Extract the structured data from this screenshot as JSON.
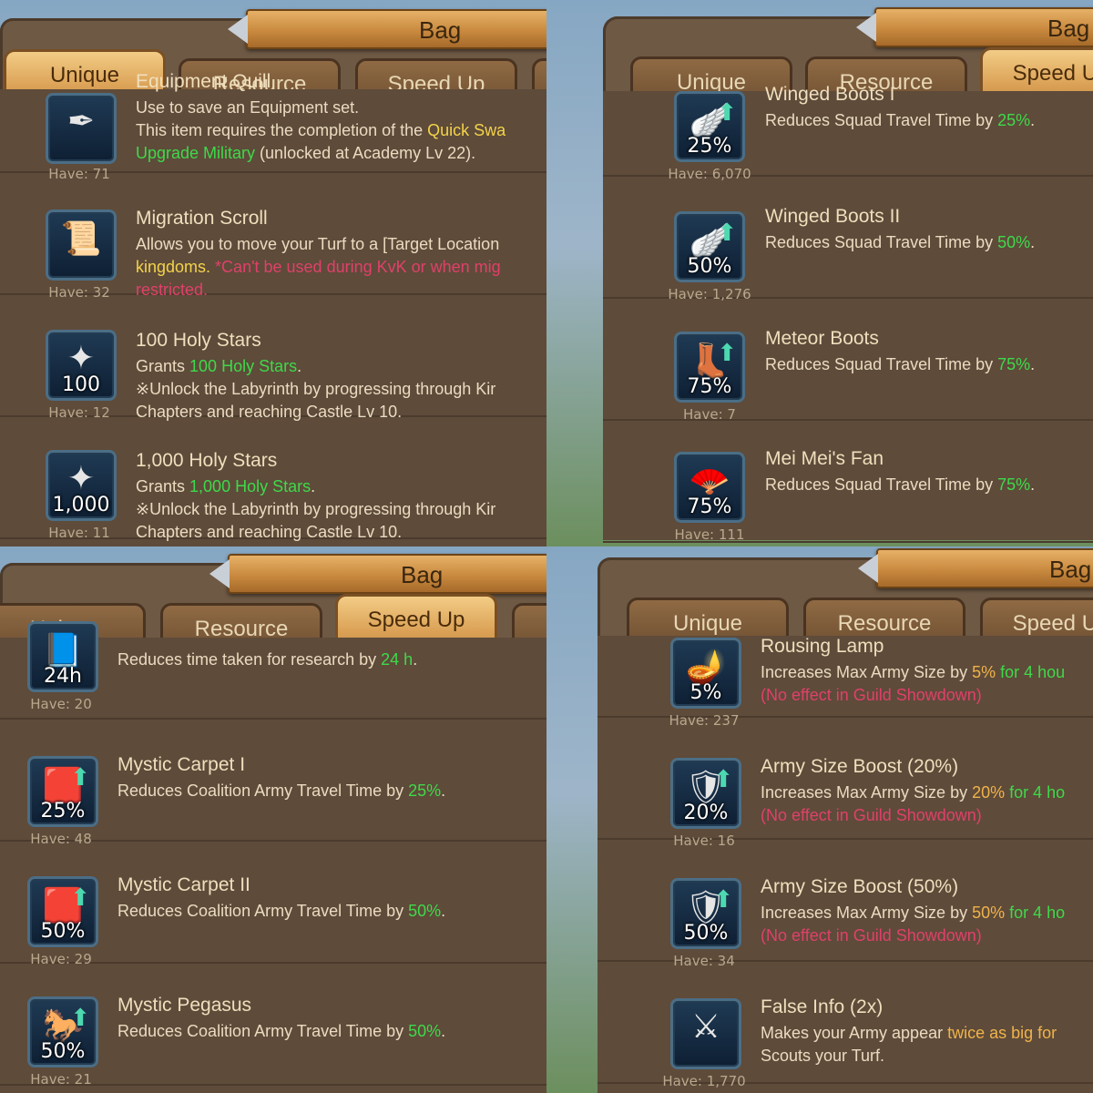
{
  "window_title": "Bag",
  "tabs": [
    "Unique",
    "Resource",
    "Speed Up"
  ],
  "panel_tl": {
    "items": [
      {
        "name": "Equipment Quill",
        "have": "Have: 71",
        "desc1": "Use to save an Equipment set.",
        "desc2a": "This item requires the completion of the ",
        "desc2b": "Quick Swa",
        "desc3a": "Upgrade Military",
        "desc3b": " (unlocked at Academy Lv 22)."
      },
      {
        "name": "Migration Scroll",
        "have": "Have: 32",
        "desc1": "Allows you to move your Turf to a [Target Location",
        "desc2a": "kingdoms.",
        "desc2b": " *Can't be used during KvK or when mig",
        "desc3": "restricted."
      },
      {
        "name": "100 Holy Stars",
        "have": "Have: 12",
        "badge": "100",
        "desc1a": "Grants ",
        "desc1b": "100 Holy Stars",
        "desc1c": ".",
        "desc2": "※Unlock the Labyrinth by progressing through Kir",
        "desc3": "Chapters and reaching Castle Lv 10."
      },
      {
        "name": "1,000 Holy Stars",
        "have": "Have: 11",
        "badge": "1,000",
        "desc1a": "Grants ",
        "desc1b": "1,000 Holy Stars",
        "desc1c": ".",
        "desc2": "※Unlock the Labyrinth by progressing through Kir",
        "desc3": "Chapters and reaching Castle Lv 10."
      }
    ]
  },
  "panel_tr": {
    "items": [
      {
        "name": "Winged Boots I",
        "have": "Have: 6,070",
        "badge": "25%",
        "desc_a": "Reduces Squad Travel Time by ",
        "desc_b": "25%",
        "desc_c": "."
      },
      {
        "name": "Winged Boots II",
        "have": "Have: 1,276",
        "badge": "50%",
        "desc_a": "Reduces Squad Travel Time by ",
        "desc_b": "50%",
        "desc_c": "."
      },
      {
        "name": "Meteor Boots",
        "have": "Have: 7",
        "badge": "75%",
        "desc_a": "Reduces Squad Travel Time by ",
        "desc_b": "75%",
        "desc_c": "."
      },
      {
        "name": "Mei Mei's Fan",
        "have": "Have: 111",
        "badge": "75%",
        "desc_a": "Reduces Squad Travel Time by ",
        "desc_b": "75%",
        "desc_c": "."
      }
    ]
  },
  "panel_bl": {
    "items": [
      {
        "name": "",
        "have": "Have: 20",
        "badge": "24h",
        "desc_a": "Reduces time taken for research by ",
        "desc_b": "24 h",
        "desc_c": "."
      },
      {
        "name": "Mystic Carpet I",
        "have": "Have: 48",
        "badge": "25%",
        "desc_a": "Reduces Coalition Army Travel Time by ",
        "desc_b": "25%",
        "desc_c": "."
      },
      {
        "name": "Mystic Carpet II",
        "have": "Have: 29",
        "badge": "50%",
        "desc_a": "Reduces Coalition Army Travel Time by ",
        "desc_b": "50%",
        "desc_c": "."
      },
      {
        "name": "Mystic Pegasus",
        "have": "Have: 21",
        "badge": "50%",
        "desc_a": "Reduces Coalition Army Travel Time by ",
        "desc_b": "50%",
        "desc_c": "."
      }
    ]
  },
  "panel_br": {
    "items": [
      {
        "name": "Rousing Lamp",
        "have": "Have: 237",
        "badge": "5%",
        "desc1a": "Increases Max Army Size by ",
        "desc1b": "5%",
        "desc1c": " for 4 hou",
        "desc2": "(No effect in Guild Showdown)"
      },
      {
        "name": "Army Size Boost (20%)",
        "have": "Have: 16",
        "badge": "20%",
        "desc1a": "Increases Max Army Size by ",
        "desc1b": "20%",
        "desc1c": " for 4 ho",
        "desc2": "(No effect in Guild Showdown)"
      },
      {
        "name": "Army Size Boost (50%)",
        "have": "Have: 34",
        "badge": "50%",
        "desc1a": "Increases Max Army Size by ",
        "desc1b": "50%",
        "desc1c": " for 4 ho",
        "desc2": "(No effect in Guild Showdown)"
      },
      {
        "name": "False Info (2x)",
        "have": "Have: 1,770",
        "desc1a": "Makes your Army appear ",
        "desc1b": "twice as big",
        "desc1c": " for",
        "desc2": "Scouts your Turf."
      }
    ]
  },
  "colors": {
    "highlight_green": "#3fd94a",
    "highlight_yellow": "#f3d34a",
    "warning_red": "#e0406a",
    "highlight_orange": "#f0b34a"
  }
}
